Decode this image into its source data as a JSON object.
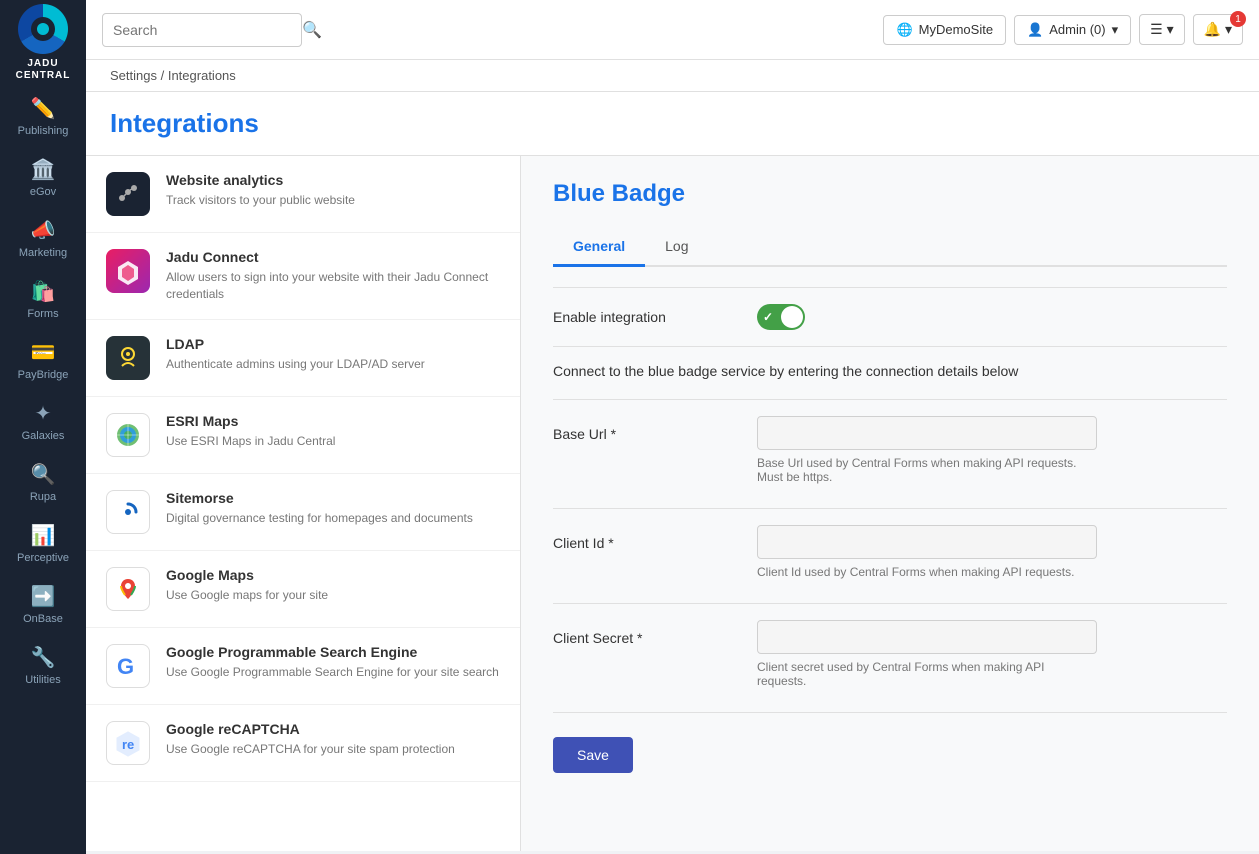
{
  "app": {
    "name": "JADU CENTRAL",
    "logo_label": "JADU\nCENTRAL"
  },
  "topbar": {
    "search_placeholder": "Search",
    "site_button": "MyDemoSite",
    "admin_button": "Admin (0)"
  },
  "breadcrumb": {
    "settings": "Settings",
    "separator": "/",
    "current": "Integrations"
  },
  "page": {
    "title": "Integrations"
  },
  "sidebar": {
    "items": [
      {
        "id": "publishing",
        "label": "Publishing",
        "icon": "✏️"
      },
      {
        "id": "egov",
        "label": "eGov",
        "icon": "🏛️"
      },
      {
        "id": "marketing",
        "label": "Marketing",
        "icon": "📣"
      },
      {
        "id": "forms",
        "label": "Forms",
        "icon": "🛍️"
      },
      {
        "id": "paybridge",
        "label": "PayBridge",
        "icon": "💳"
      },
      {
        "id": "galaxies",
        "label": "Galaxies",
        "icon": "✦"
      },
      {
        "id": "rupa",
        "label": "Rupa",
        "icon": "🔍"
      },
      {
        "id": "perceptive",
        "label": "Perceptive",
        "icon": "📊"
      },
      {
        "id": "onbase",
        "label": "OnBase",
        "icon": "➡️"
      },
      {
        "id": "utilities",
        "label": "Utilities",
        "icon": "🔧"
      }
    ]
  },
  "integrations": [
    {
      "id": "website-analytics",
      "name": "Website analytics",
      "description": "Track visitors to your public website",
      "icon_type": "analytics"
    },
    {
      "id": "jadu-connect",
      "name": "Jadu Connect",
      "description": "Allow users to sign into your website with their Jadu Connect credentials",
      "icon_type": "jadu"
    },
    {
      "id": "ldap",
      "name": "LDAP",
      "description": "Authenticate admins using your LDAP/AD server",
      "icon_type": "ldap"
    },
    {
      "id": "esri-maps",
      "name": "ESRI Maps",
      "description": "Use ESRI Maps in Jadu Central",
      "icon_type": "esri"
    },
    {
      "id": "sitemorse",
      "name": "Sitemorse",
      "description": "Digital governance testing for homepages and documents",
      "icon_type": "sitemorse"
    },
    {
      "id": "google-maps",
      "name": "Google Maps",
      "description": "Use Google maps for your site",
      "icon_type": "googlemaps"
    },
    {
      "id": "google-pse",
      "name": "Google Programmable Search Engine",
      "description": "Use Google Programmable Search Engine for your site search",
      "icon_type": "google"
    },
    {
      "id": "google-recaptcha",
      "name": "Google reCAPTCHA",
      "description": "Use Google reCAPTCHA for your site spam protection",
      "icon_type": "recaptcha"
    }
  ],
  "detail_panel": {
    "title": "Blue Badge",
    "tabs": [
      "General",
      "Log"
    ],
    "active_tab": "General",
    "enable_label": "Enable integration",
    "toggle_enabled": true,
    "connect_text": "Connect to the blue badge service by entering the connection details below",
    "fields": [
      {
        "id": "base-url",
        "label": "Base Url *",
        "placeholder": "",
        "hint": "Base Url used by Central Forms when making API requests. Must be https."
      },
      {
        "id": "client-id",
        "label": "Client Id *",
        "placeholder": "",
        "hint": "Client Id used by Central Forms when making API requests."
      },
      {
        "id": "client-secret",
        "label": "Client Secret *",
        "placeholder": "",
        "hint": "Client secret used by Central Forms when making API requests."
      }
    ],
    "save_label": "Save"
  }
}
